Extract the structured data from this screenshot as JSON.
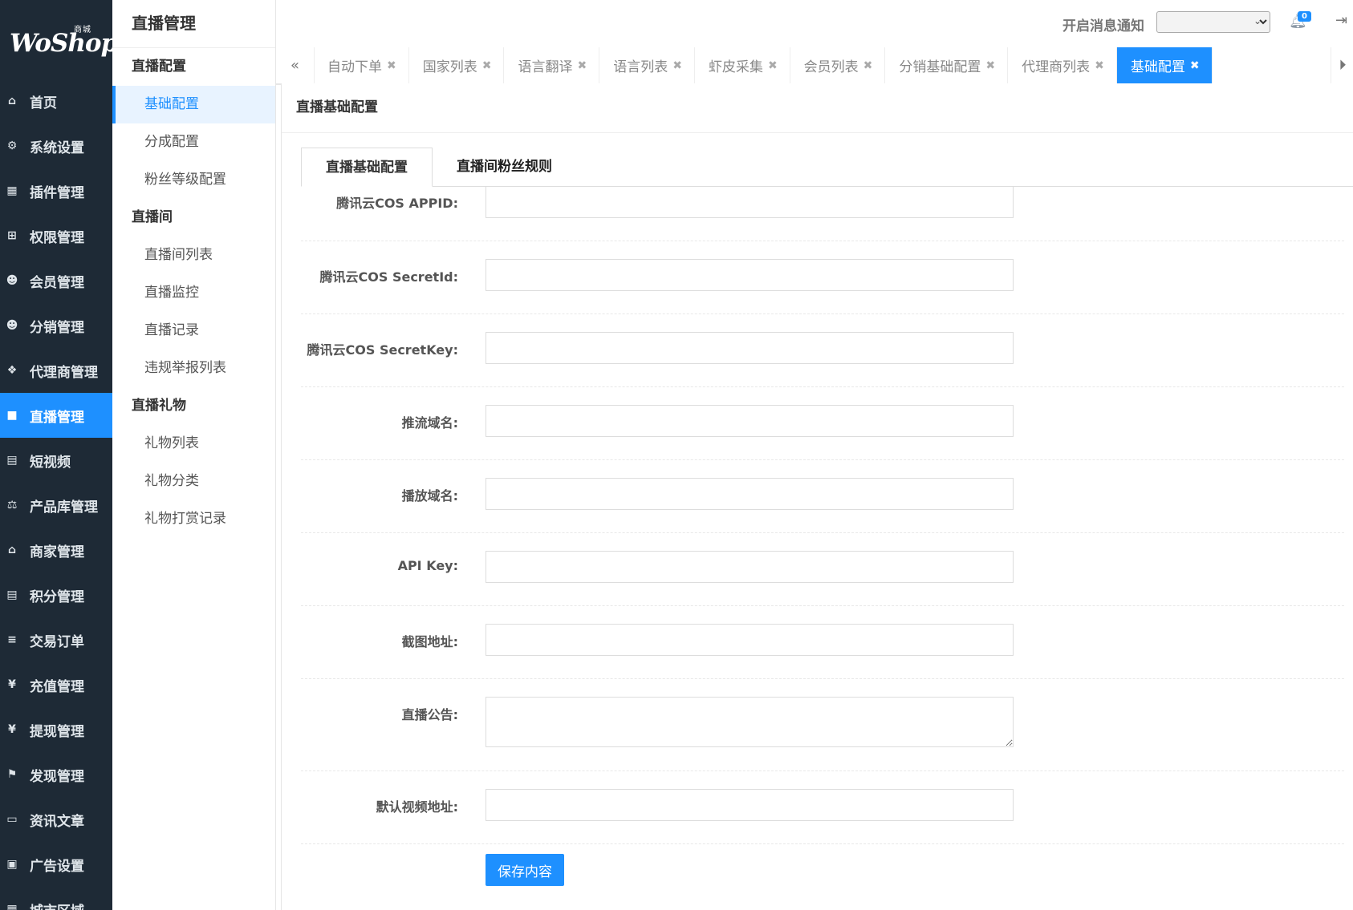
{
  "logo": {
    "main": "WoShop",
    "sup": "商城"
  },
  "nav": {
    "items": [
      {
        "label": "首页",
        "icon": "home-icon",
        "glyph": "⌂"
      },
      {
        "label": "系统设置",
        "icon": "gear-icon",
        "glyph": "⚙"
      },
      {
        "label": "插件管理",
        "icon": "plugin-icon",
        "glyph": "▦"
      },
      {
        "label": "权限管理",
        "icon": "sitemap-icon",
        "glyph": "⊞"
      },
      {
        "label": "会员管理",
        "icon": "users-icon",
        "glyph": "☻"
      },
      {
        "label": "分销管理",
        "icon": "users-icon",
        "glyph": "☻"
      },
      {
        "label": "代理商管理",
        "icon": "cubes-icon",
        "glyph": "❖"
      },
      {
        "label": "直播管理",
        "icon": "video-camera-icon",
        "glyph": "■"
      },
      {
        "label": "短视频",
        "icon": "file-video-icon",
        "glyph": "▤"
      },
      {
        "label": "产品库管理",
        "icon": "balance-scale-icon",
        "glyph": "⚖"
      },
      {
        "label": "商家管理",
        "icon": "bank-icon",
        "glyph": "⌂"
      },
      {
        "label": "积分管理",
        "icon": "file-icon",
        "glyph": "▤"
      },
      {
        "label": "交易订单",
        "icon": "sliders-icon",
        "glyph": "≡"
      },
      {
        "label": "充值管理",
        "icon": "yen-icon",
        "glyph": "¥"
      },
      {
        "label": "提现管理",
        "icon": "yen-icon",
        "glyph": "¥"
      },
      {
        "label": "发现管理",
        "icon": "flag-icon",
        "glyph": "⚑"
      },
      {
        "label": "资讯文章",
        "icon": "newspaper-icon",
        "glyph": "▭"
      },
      {
        "label": "广告设置",
        "icon": "image-icon",
        "glyph": "▣"
      },
      {
        "label": "城市区域",
        "icon": "map-icon",
        "glyph": "▦"
      }
    ]
  },
  "subnav": {
    "title": "直播管理",
    "group1": "直播配置",
    "g1_items": [
      "基础配置",
      "分成配置",
      "粉丝等级配置"
    ],
    "group2": "直播间",
    "g2_items": [
      "直播间列表",
      "直播监控",
      "直播记录",
      "违规举报列表"
    ],
    "group3": "直播礼物",
    "g3_items": [
      "礼物列表",
      "礼物分类",
      "礼物打赏记录"
    ]
  },
  "topbar": {
    "notif_label": "开启消息通知",
    "notif_select_value": "",
    "badge_count": "0"
  },
  "tabs": [
    "自动下单",
    "国家列表",
    "语言翻译",
    "语言列表",
    "虾皮采集",
    "会员列表",
    "分销基础配置",
    "代理商列表",
    "基础配置"
  ],
  "panel": {
    "title": "直播基础配置",
    "form_tabs": [
      "直播基础配置",
      "直播间粉丝规则"
    ],
    "fields": [
      {
        "label": "腾讯云COS APPID:",
        "value": ""
      },
      {
        "label": "腾讯云COS SecretId:",
        "value": ""
      },
      {
        "label": "腾讯云COS SecretKey:",
        "value": ""
      },
      {
        "label": "推流域名:",
        "value": ""
      },
      {
        "label": "播放域名:",
        "value": ""
      },
      {
        "label": "API Key:",
        "value": ""
      },
      {
        "label": "截图地址:",
        "value": ""
      },
      {
        "label": "直播公告:",
        "value": ""
      },
      {
        "label": "默认视频地址:",
        "value": ""
      }
    ],
    "save_label": "保存内容"
  }
}
